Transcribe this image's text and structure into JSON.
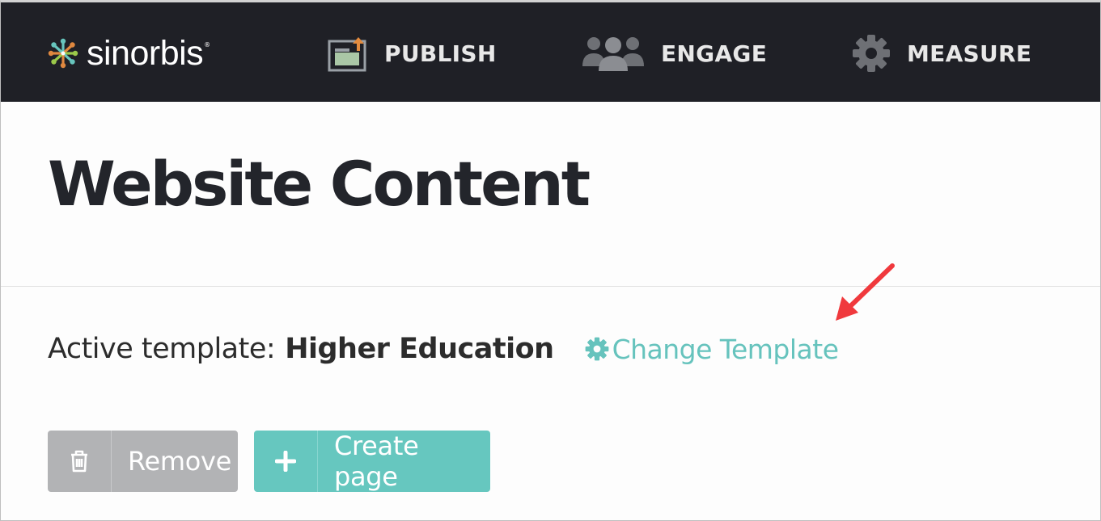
{
  "navbar": {
    "brand": "sinorbis",
    "brand_mark": "®",
    "items": [
      {
        "label": "PUBLISH",
        "icon": "publish-upload-icon"
      },
      {
        "label": "ENGAGE",
        "icon": "users-group-icon"
      },
      {
        "label": "MEASURE",
        "icon": "gear-icon"
      }
    ]
  },
  "header": {
    "title": "Website Content"
  },
  "template": {
    "label": "Active template:",
    "value": "Higher Education",
    "change_link": "Change Template",
    "change_icon": "gear-icon"
  },
  "actions": {
    "remove_label": "Remove",
    "remove_icon": "trash-icon",
    "create_label": "Create page",
    "create_icon": "plus-icon"
  },
  "colors": {
    "navbar_bg": "#1f2026",
    "accent_teal": "#66c7bf",
    "remove_gray": "#b2b3b5",
    "annotation_red": "#f0393d"
  }
}
